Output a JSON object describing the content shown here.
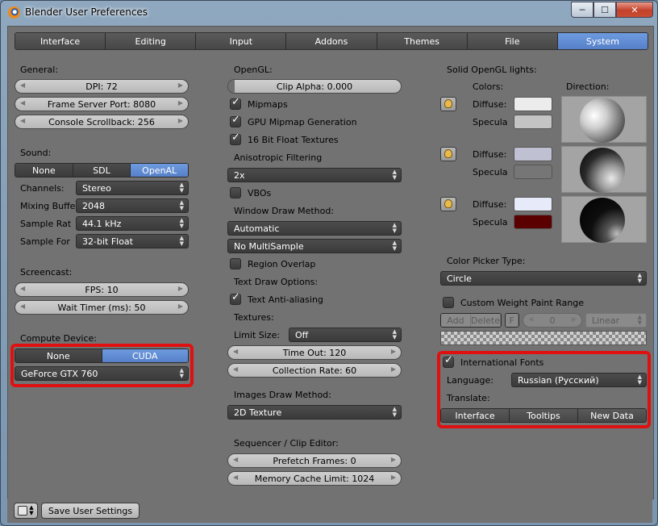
{
  "window": {
    "title": "Blender User Preferences",
    "buttons": {
      "minimize": "─",
      "maximize": "☐",
      "close": "✕"
    }
  },
  "tabs": [
    "Interface",
    "Editing",
    "Input",
    "Addons",
    "Themes",
    "File",
    "System"
  ],
  "active_tab": "System",
  "left": {
    "general_label": "General:",
    "dpi": "DPI: 72",
    "frame_server_port": "Frame Server Port: 8080",
    "console_scrollback": "Console Scrollback: 256",
    "sound_label": "Sound:",
    "sound_options": [
      "None",
      "SDL",
      "OpenAL"
    ],
    "sound_active": "OpenAL",
    "channels_label": "Channels:",
    "channels_value": "Stereo",
    "mixing_label": "Mixing Buffe",
    "mixing_value": "2048",
    "sample_rate_label": "Sample Rat",
    "sample_rate_value": "44.1 kHz",
    "sample_format_label": "Sample For",
    "sample_format_value": "32-bit Float",
    "screencast_label": "Screencast:",
    "fps": "FPS: 10",
    "wait_timer": "Wait Timer (ms): 50",
    "compute_label": "Compute Device:",
    "compute_options": [
      "None",
      "CUDA"
    ],
    "compute_active": "CUDA",
    "gpu_value": "GeForce GTX 760"
  },
  "middle": {
    "opengl_label": "OpenGL:",
    "clip_alpha": "Clip Alpha: 0.000",
    "mipmaps": "Mipmaps",
    "gpu_mipmap": "GPU Mipmap Generation",
    "float_textures": "16 Bit Float Textures",
    "aniso_label": "Anisotropic Filtering",
    "aniso_value": "2x",
    "vbos": "VBOs",
    "window_draw_label": "Window Draw Method:",
    "window_draw_value": "Automatic",
    "multisample_value": "No MultiSample",
    "region_overlap": "Region Overlap",
    "text_draw_label": "Text Draw Options:",
    "text_antialias": "Text Anti-aliasing",
    "textures_label": "Textures:",
    "limit_size_label": "Limit Size:",
    "limit_size_value": "Off",
    "time_out": "Time Out: 120",
    "collection_rate": "Collection Rate: 60",
    "images_draw_label": "Images Draw Method:",
    "images_draw_value": "2D Texture",
    "sequencer_label": "Sequencer / Clip Editor:",
    "prefetch_frames": "Prefetch Frames: 0",
    "memory_cache": "Memory Cache Limit: 1024"
  },
  "right": {
    "solid_lights_label": "Solid OpenGL lights:",
    "colors_label": "Colors:",
    "direction_label": "Direction:",
    "diffuse_label": "Diffuse:",
    "specular_label": "Specula",
    "lights": [
      {
        "diffuse": "#ececec",
        "specular": "#c4c4c4"
      },
      {
        "diffuse": "#bfc0d2",
        "specular": "#767676"
      },
      {
        "diffuse": "#e6eaf9",
        "specular": "#5a0000"
      }
    ],
    "color_picker_label": "Color Picker Type:",
    "color_picker_value": "Circle",
    "custom_weight": "Custom Weight Paint Range",
    "add": "Add",
    "delete": "Delete",
    "f": "F",
    "ramp_value": "0",
    "interp_value": "Linear",
    "intl_fonts": "International Fonts",
    "language_label": "Language:",
    "language_value": "Russian (Русский)",
    "translate_label": "Translate:",
    "translate_options": [
      "Interface",
      "Tooltips",
      "New Data"
    ]
  },
  "footer": {
    "save_label": "Save User Settings"
  },
  "colors": {
    "highlight": "#e01010",
    "active_blue": "#5680c8"
  }
}
